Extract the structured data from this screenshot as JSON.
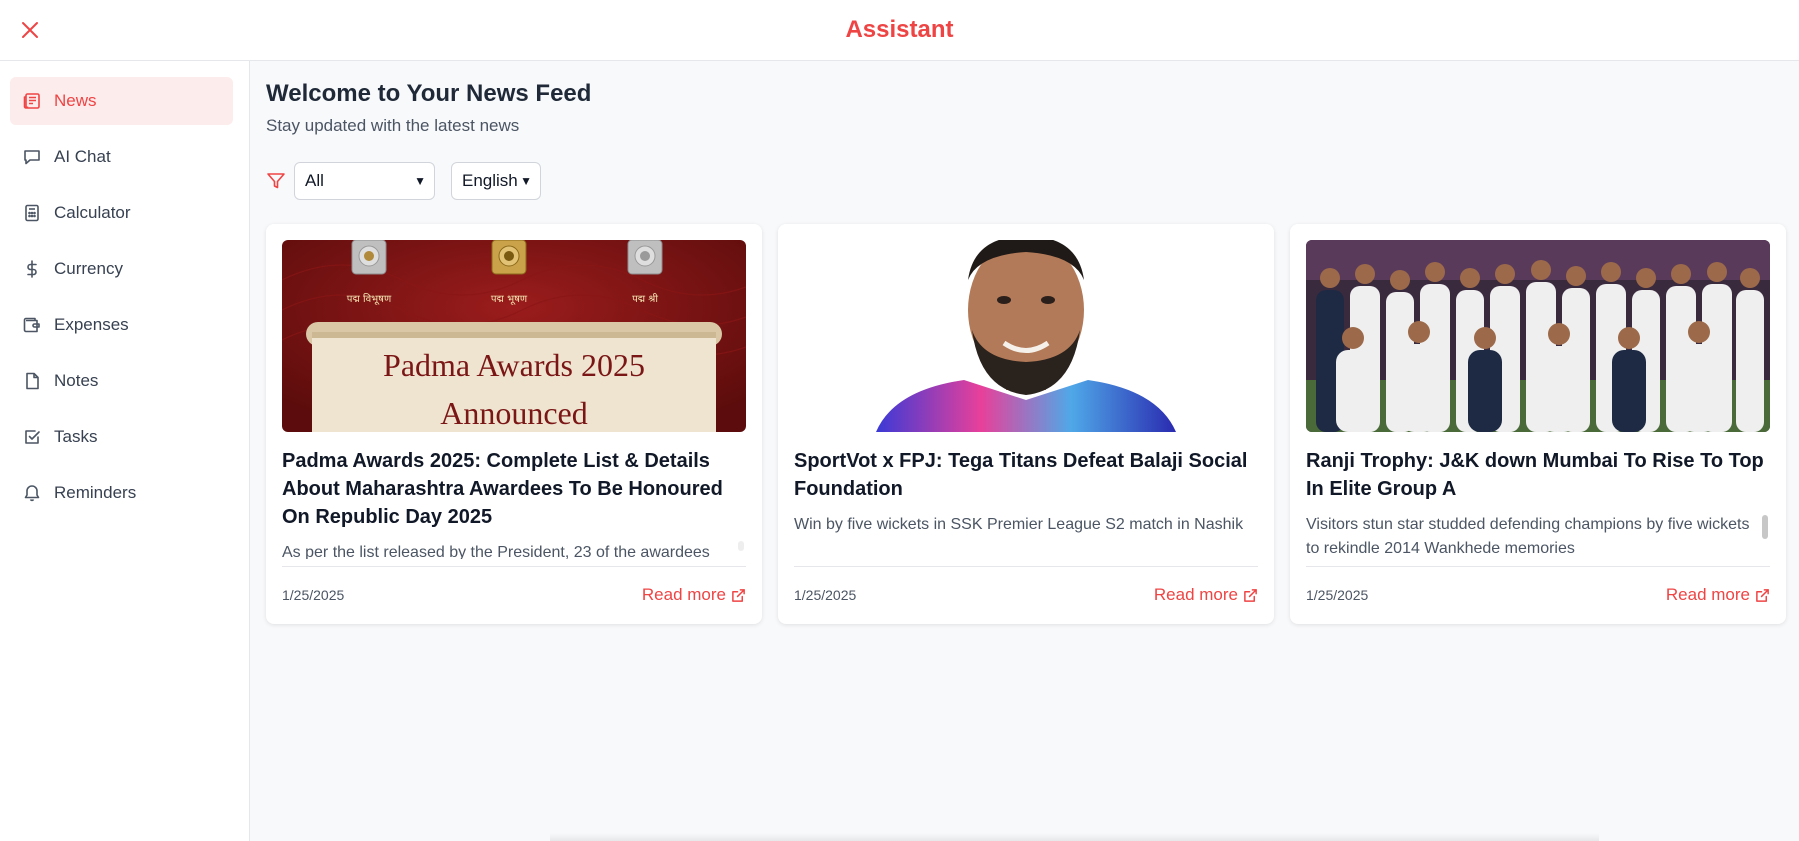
{
  "app": {
    "title": "Assistant",
    "accent_color": "#ef4444"
  },
  "sidebar": {
    "items": [
      {
        "label": "News",
        "icon": "newspaper-icon",
        "active": true
      },
      {
        "label": "AI Chat",
        "icon": "chat-bubble-icon",
        "active": false
      },
      {
        "label": "Calculator",
        "icon": "calculator-icon",
        "active": false
      },
      {
        "label": "Currency",
        "icon": "dollar-icon",
        "active": false
      },
      {
        "label": "Expenses",
        "icon": "wallet-icon",
        "active": false
      },
      {
        "label": "Notes",
        "icon": "file-icon",
        "active": false
      },
      {
        "label": "Tasks",
        "icon": "checkbox-icon",
        "active": false
      },
      {
        "label": "Reminders",
        "icon": "bell-icon",
        "active": false
      }
    ]
  },
  "main": {
    "title": "Welcome to Your News Feed",
    "subtitle": "Stay updated with the latest news",
    "filters": {
      "category": "All",
      "language": "English"
    }
  },
  "articles": [
    {
      "title": "Padma Awards 2025: Complete List & Details About Maharashtra Awardees To Be Honoured On Republic Day 2025",
      "description": "As per the list released by the President, 23 of the awardees",
      "date": "1/25/2025",
      "read_more": "Read more",
      "image": {
        "alt": "padma-awards-banner",
        "medal_labels": [
          "पद्म विभूषण",
          "पद्म भूषण",
          "पद्म श्री"
        ],
        "line1": "Padma Awards 2025",
        "line2": "Announced"
      }
    },
    {
      "title": "SportVot x FPJ: Tega Titans Defeat Balaji Social Foundation",
      "description": "Win by five wickets in SSK Premier League S2 match in Nashik",
      "date": "1/25/2025",
      "read_more": "Read more",
      "image": {
        "alt": "player-portrait"
      }
    },
    {
      "title": "Ranji Trophy: J&K down Mumbai To Rise To Top In Elite Group A",
      "description": "Visitors stun star studded defending champions by five wickets to rekindle 2014 Wankhede memories",
      "date": "1/25/2025",
      "read_more": "Read more",
      "image": {
        "alt": "team-celebration-photo"
      }
    }
  ]
}
